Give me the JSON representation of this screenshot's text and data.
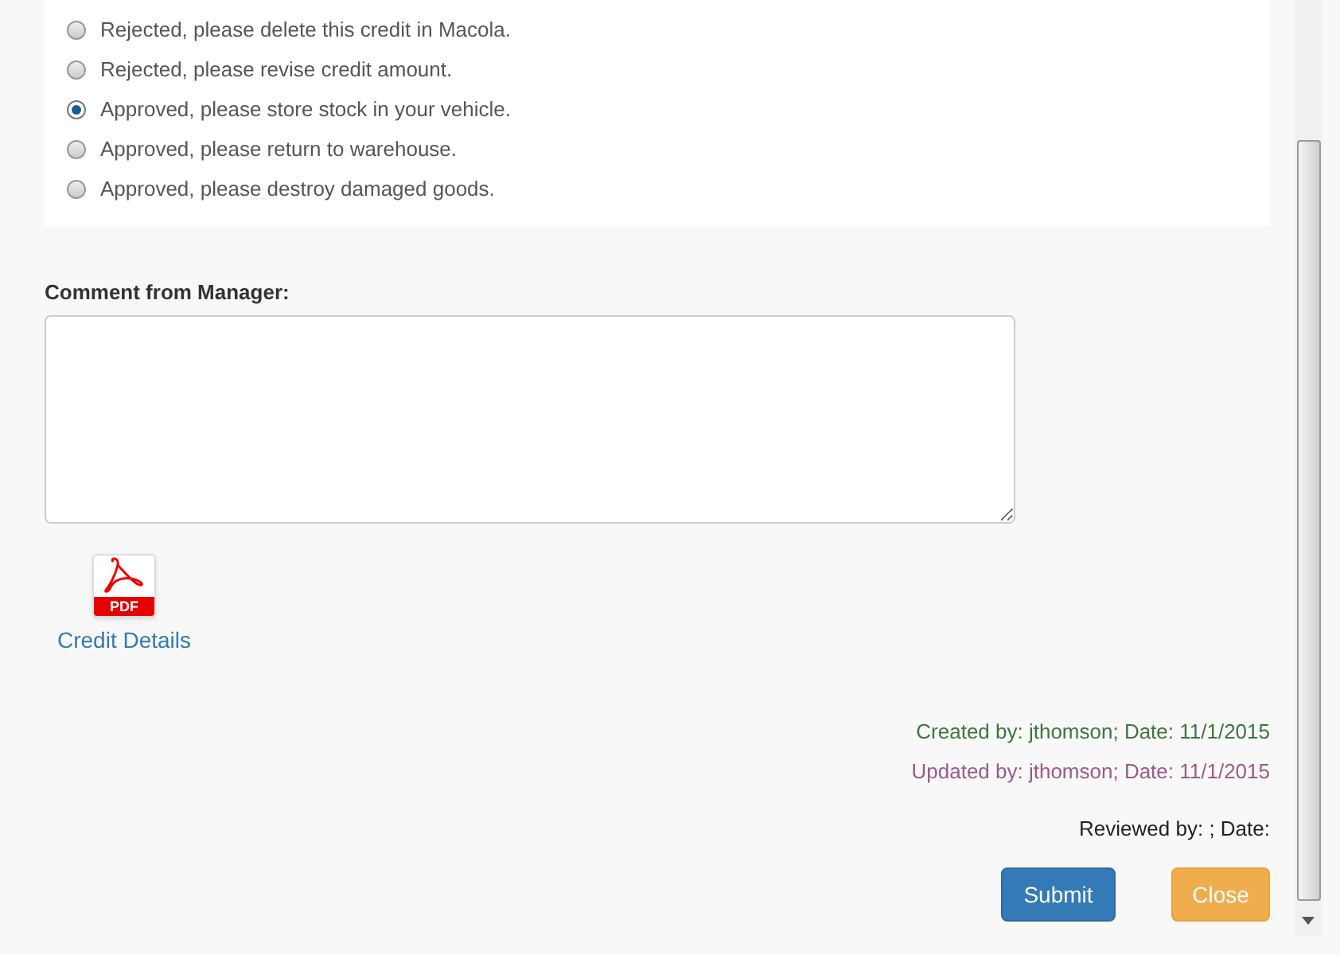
{
  "options": [
    {
      "label": "Rejected, please delete this credit in Macola.",
      "selected": false
    },
    {
      "label": "Rejected, please revise credit amount.",
      "selected": false
    },
    {
      "label": "Approved, please store stock in your vehicle.",
      "selected": true
    },
    {
      "label": "Approved, please return to warehouse.",
      "selected": false
    },
    {
      "label": "Approved, please destroy damaged goods.",
      "selected": false
    }
  ],
  "comment": {
    "label": "Comment from Manager:"
  },
  "attachment": {
    "file_type": "PDF",
    "link": "Credit Details"
  },
  "audit": [
    {
      "kind": "created",
      "text": "Created by: jthomson; Date: 11/1/2015"
    },
    {
      "kind": "updated",
      "text": "Updated by: jthomson; Date: 11/1/2015"
    },
    {
      "kind": "reviewed",
      "text": "Reviewed by: ; Date:"
    }
  ],
  "buttons": [
    {
      "kind": "primary",
      "label": "Submit"
    },
    {
      "kind": "warning",
      "label": "Close"
    }
  ]
}
